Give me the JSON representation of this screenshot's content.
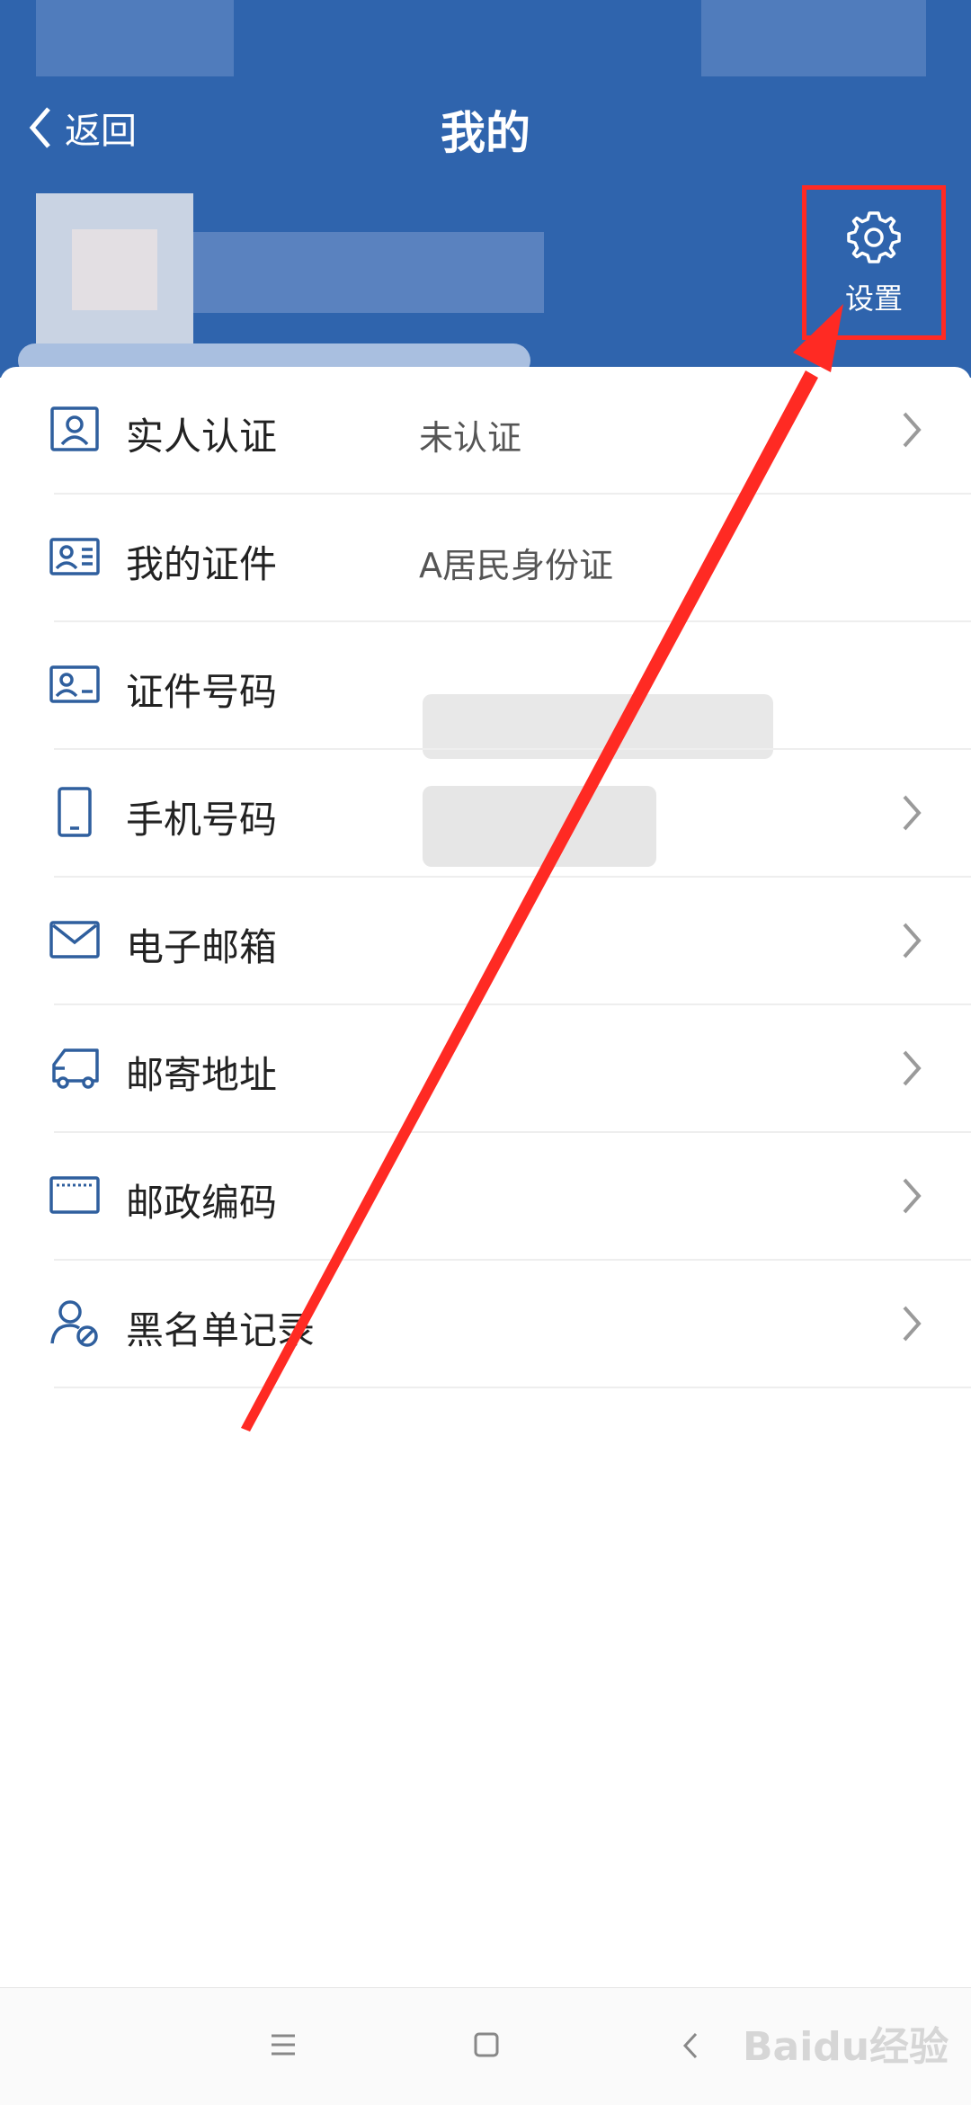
{
  "header": {
    "back_label": "返回",
    "title": "我的",
    "settings_label": "设置"
  },
  "items": [
    {
      "label": "实人认证",
      "value": "未认证",
      "icon": "id-card-person-icon",
      "has_chevron": true
    },
    {
      "label": "我的证件",
      "value": "A居民身份证",
      "icon": "id-card-icon",
      "has_chevron": false
    },
    {
      "label": "证件号码",
      "value": "",
      "icon": "id-number-icon",
      "has_chevron": false
    },
    {
      "label": "手机号码",
      "value": "",
      "icon": "phone-icon",
      "has_chevron": true
    },
    {
      "label": "电子邮箱",
      "value": "",
      "icon": "mail-icon",
      "has_chevron": true
    },
    {
      "label": "邮寄地址",
      "value": "",
      "icon": "truck-icon",
      "has_chevron": true
    },
    {
      "label": "邮政编码",
      "value": "",
      "icon": "postcode-icon",
      "has_chevron": true
    },
    {
      "label": "黑名单记录",
      "value": "",
      "icon": "user-blocked-icon",
      "has_chevron": true
    }
  ],
  "colors": {
    "header": "#2f64ad",
    "icon": "#2f5f9e",
    "annotation": "#ff2a23"
  },
  "nav": [
    "menu-icon",
    "home-icon",
    "back-icon"
  ],
  "watermark": "Baidu经验"
}
